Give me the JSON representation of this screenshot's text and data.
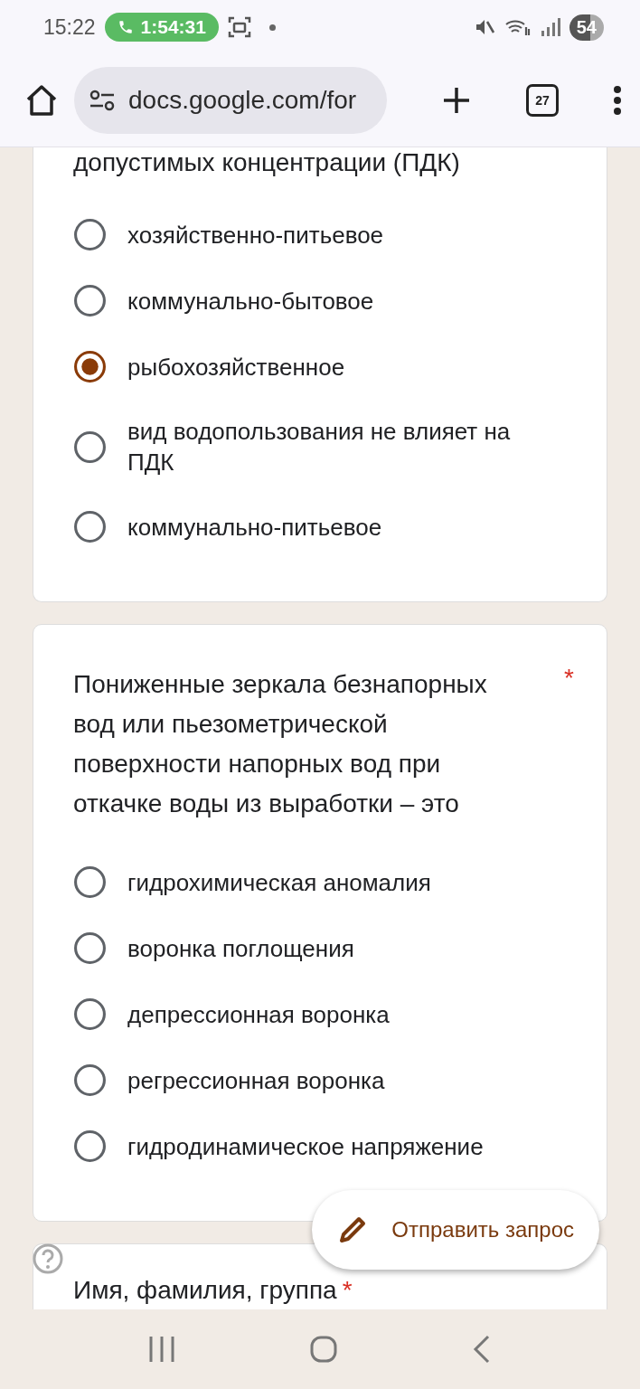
{
  "status_bar": {
    "time": "15:22",
    "call_timer": "1:54:31",
    "battery": "54"
  },
  "browser": {
    "url": "docs.google.com/for",
    "tab_count": "27"
  },
  "questions": [
    {
      "title": "допустимых концентрации (ПДК)",
      "options": [
        {
          "label": "хозяйственно-питьевое",
          "selected": false
        },
        {
          "label": "коммунально-бытовое",
          "selected": false
        },
        {
          "label": "рыбохозяйственное",
          "selected": true
        },
        {
          "label": "вид водопользования не влияет на ПДК",
          "selected": false
        },
        {
          "label": "коммунально-питьевое",
          "selected": false
        }
      ]
    },
    {
      "title": "Пониженные зеркала безнапорных вод или пьезометрической поверхности напорных вод при откачке воды из выработки – это",
      "required_mark": "*",
      "options": [
        {
          "label": "гидрохимическая аномалия",
          "selected": false
        },
        {
          "label": "воронка поглощения",
          "selected": false
        },
        {
          "label": "депрессионная воронка",
          "selected": false
        },
        {
          "label": "регрессионная воронка",
          "selected": false
        },
        {
          "label": "гидродинамическое напряжение",
          "selected": false
        }
      ]
    },
    {
      "title": "Имя, фамилия, группа",
      "required_mark": "*"
    }
  ],
  "fab": {
    "label": "Отправить запрос"
  }
}
